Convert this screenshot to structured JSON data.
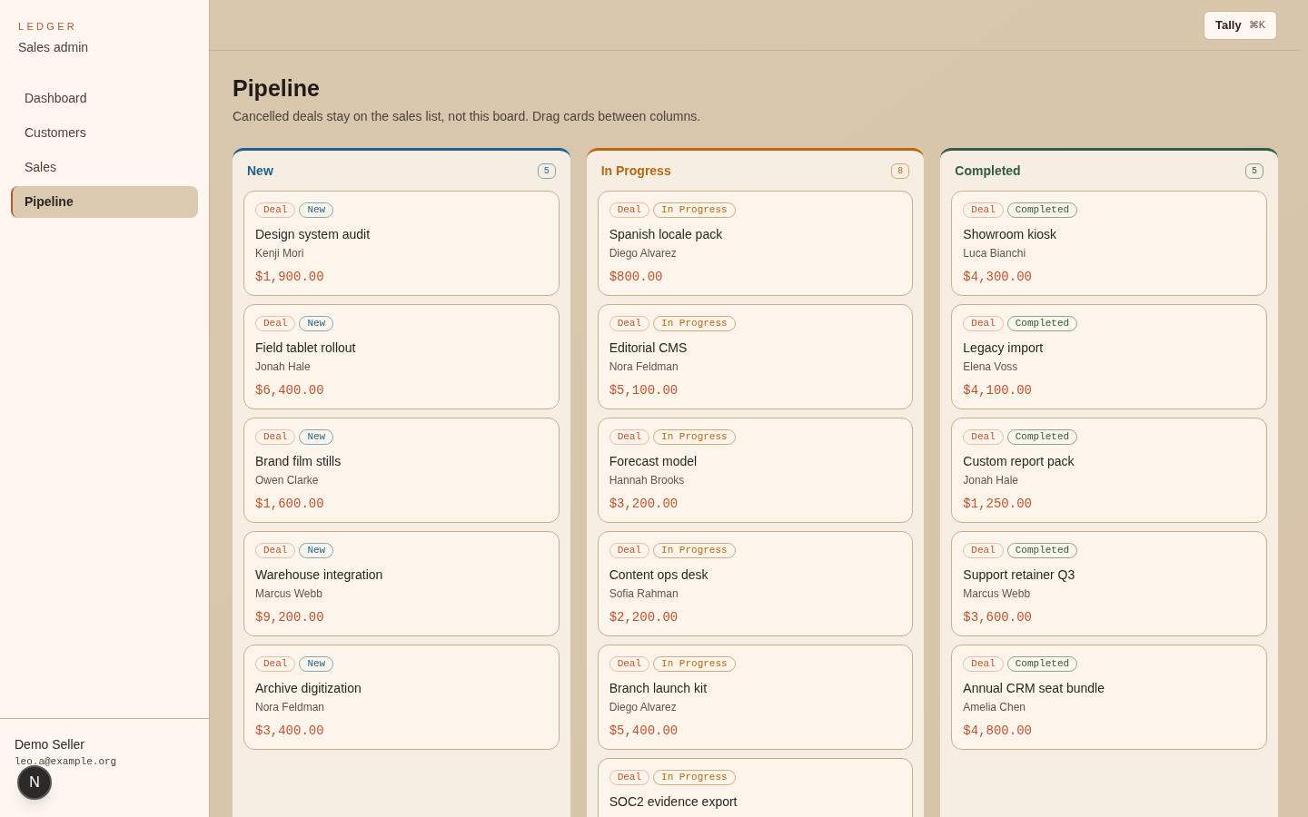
{
  "brand": {
    "logo": "LEDGER",
    "subtitle": "Sales admin"
  },
  "nav": [
    {
      "label": "Dashboard",
      "selected": false
    },
    {
      "label": "Customers",
      "selected": false
    },
    {
      "label": "Sales",
      "selected": false
    },
    {
      "label": "Pipeline",
      "selected": true
    }
  ],
  "user": {
    "name": "Demo Seller",
    "email": "leo.a@example.org"
  },
  "dev_badge": "N",
  "topbar": {
    "button": "Tally",
    "shortcut": "⌘K"
  },
  "page": {
    "title": "Pipeline",
    "description": "Cancelled deals stay on the sales list, not this board. Drag cards between columns."
  },
  "columns": [
    {
      "name": "New",
      "count": "5",
      "color": "#1f5f8b",
      "cards": [
        {
          "type": "Deal",
          "stage": "New",
          "title": "Design system audit",
          "customer": "Kenji Mori",
          "amount": "$1,900.00"
        },
        {
          "type": "Deal",
          "stage": "New",
          "title": "Field tablet rollout",
          "customer": "Jonah Hale",
          "amount": "$6,400.00"
        },
        {
          "type": "Deal",
          "stage": "New",
          "title": "Brand film stills",
          "customer": "Owen Clarke",
          "amount": "$1,600.00"
        },
        {
          "type": "Deal",
          "stage": "New",
          "title": "Warehouse integration",
          "customer": "Marcus Webb",
          "amount": "$9,200.00"
        },
        {
          "type": "Deal",
          "stage": "New",
          "title": "Archive digitization",
          "customer": "Nora Feldman",
          "amount": "$3,400.00"
        }
      ]
    },
    {
      "name": "In Progress",
      "count": "8",
      "color": "#b8680f",
      "cards": [
        {
          "type": "Deal",
          "stage": "In Progress",
          "title": "Spanish locale pack",
          "customer": "Diego Alvarez",
          "amount": "$800.00"
        },
        {
          "type": "Deal",
          "stage": "In Progress",
          "title": "Editorial CMS",
          "customer": "Nora Feldman",
          "amount": "$5,100.00"
        },
        {
          "type": "Deal",
          "stage": "In Progress",
          "title": "Forecast model",
          "customer": "Hannah Brooks",
          "amount": "$3,200.00"
        },
        {
          "type": "Deal",
          "stage": "In Progress",
          "title": "Content ops desk",
          "customer": "Sofia Rahman",
          "amount": "$2,200.00"
        },
        {
          "type": "Deal",
          "stage": "In Progress",
          "title": "Branch launch kit",
          "customer": "Diego Alvarez",
          "amount": "$5,400.00"
        },
        {
          "type": "Deal",
          "stage": "In Progress",
          "title": "SOC2 evidence export"
        }
      ]
    },
    {
      "name": "Completed",
      "count": "5",
      "color": "#2f5d45",
      "cards": [
        {
          "type": "Deal",
          "stage": "Completed",
          "title": "Showroom kiosk",
          "customer": "Luca Bianchi",
          "amount": "$4,300.00"
        },
        {
          "type": "Deal",
          "stage": "Completed",
          "title": "Legacy import",
          "customer": "Elena Voss",
          "amount": "$4,100.00"
        },
        {
          "type": "Deal",
          "stage": "Completed",
          "title": "Custom report pack",
          "customer": "Jonah Hale",
          "amount": "$1,250.00"
        },
        {
          "type": "Deal",
          "stage": "Completed",
          "title": "Support retainer Q3",
          "customer": "Marcus Webb",
          "amount": "$3,600.00"
        },
        {
          "type": "Deal",
          "stage": "Completed",
          "title": "Annual CRM seat bundle",
          "customer": "Amelia Chen",
          "amount": "$4,800.00"
        }
      ]
    }
  ]
}
